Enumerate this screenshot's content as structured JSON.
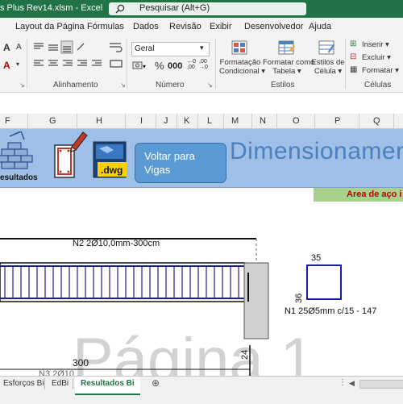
{
  "titlebar": {
    "file_title": "s Plus Rev14.xlsm  -  Excel",
    "search_placeholder": "Pesquisar (Alt+G)",
    "bg_color": "#217346"
  },
  "menu": [
    "Layout da Página",
    "Fórmulas",
    "Dados",
    "Revisão",
    "Exibir",
    "Desenvolvedor",
    "Ajuda"
  ],
  "ribbon": {
    "number_format": "Geral",
    "groups": {
      "alignment": "Alinhamento",
      "number": "Número",
      "styles": "Estilos",
      "cells": "Células"
    },
    "styles_buttons": {
      "conditional": [
        "Formatação",
        "Condicional"
      ],
      "as_table": [
        "Formatar como",
        "Tabela"
      ],
      "cell_styles": [
        "Estilos de",
        "Célula"
      ]
    },
    "cells_buttons": {
      "insert": "Inserir",
      "delete": "Excluir",
      "format": "Formatar"
    }
  },
  "columns": [
    "F",
    "G",
    "H",
    "I",
    "J",
    "K",
    "L",
    "M",
    "N",
    "O",
    "P",
    "Q"
  ],
  "banner": {
    "results_label": "esultados",
    "dwg_label": ".dwg",
    "back_button": "Voltar para Vigas",
    "heading": "Dimensionamen",
    "steel_area": "Area de aço i",
    "bg_color": "#9fc0e6"
  },
  "drawing": {
    "top_bar_label": "N2 2Ø10,0mm-300cm",
    "section_width": "35",
    "section_height": "36",
    "stirrup_label": "N1 25Ø5mm c/15 - 147",
    "length_label": "300",
    "depth_label": "24",
    "bottom_bar_label": "N3 2Ø10...",
    "watermark": "Página 1"
  },
  "sheet_tabs": [
    "Esforços Bi",
    "EdBi",
    "Resultados Bi"
  ],
  "active_tab": "Resultados Bi"
}
